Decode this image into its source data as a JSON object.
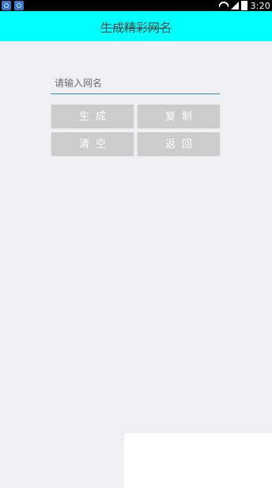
{
  "status_bar": {
    "time": "3:20",
    "icons": [
      "app-icon-1",
      "app-icon-2",
      "wifi-icon",
      "signal-icon",
      "battery-icon"
    ]
  },
  "header": {
    "title": "生成精彩网名",
    "background_color": "#00FFFF"
  },
  "form": {
    "name_input": {
      "placeholder": "请输入网名",
      "value": ""
    },
    "buttons": {
      "generate": "生成",
      "copy": "复制",
      "clear": "清空",
      "back": "返回"
    }
  },
  "colors": {
    "accent_underline": "#2F8FC4",
    "button_bg": "#CCCCCC",
    "page_bg": "#EFEFF4"
  }
}
